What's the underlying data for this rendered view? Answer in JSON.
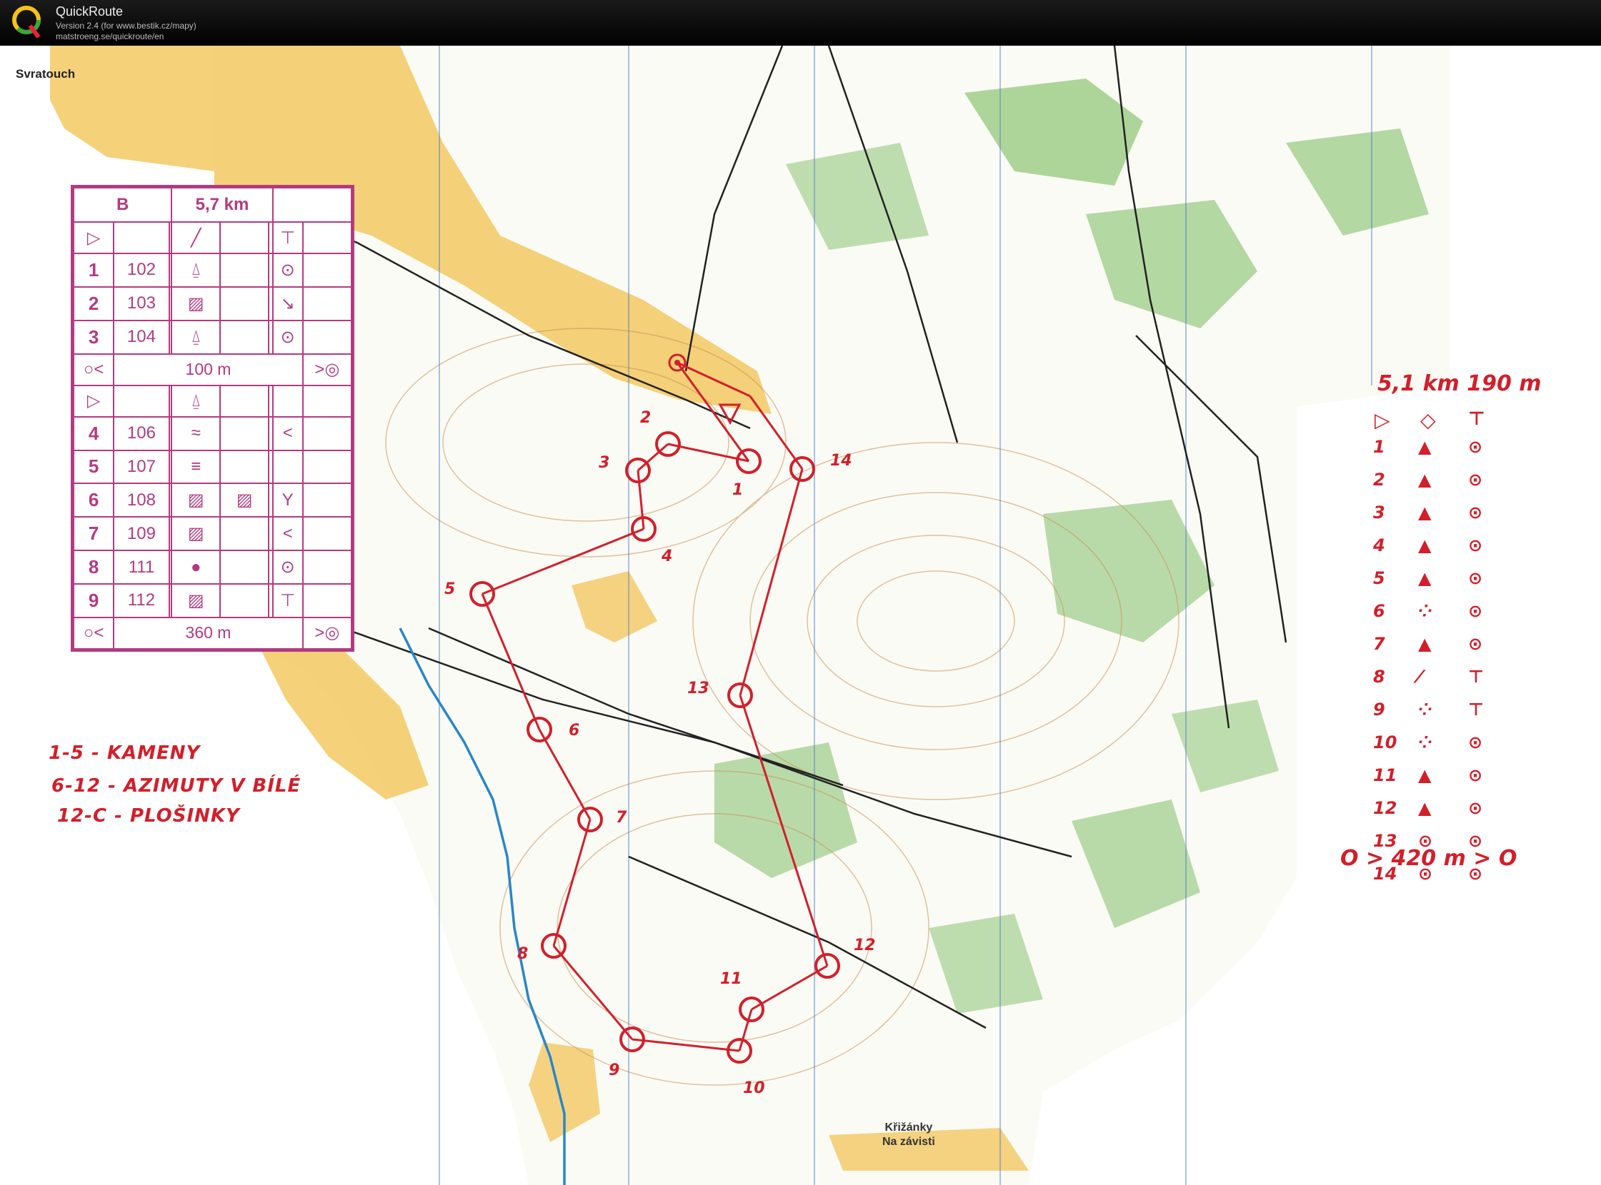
{
  "app": {
    "name": "QuickRoute",
    "version": "Version 2.4  (for www.bestik.cz/mapy)",
    "url": "matstroeng.se/quickroute/en"
  },
  "places": {
    "svratouch": "Svratouch",
    "krizanky_line1": "Křižánky",
    "krizanky_line2": "Na závisti"
  },
  "description": {
    "class": "B",
    "length": "5,7 km",
    "section1": [
      {
        "num": "1",
        "code": "102"
      },
      {
        "num": "2",
        "code": "103"
      },
      {
        "num": "3",
        "code": "104"
      }
    ],
    "marked1": "100 m",
    "section2": [
      {
        "num": "4",
        "code": "106"
      },
      {
        "num": "5",
        "code": "107"
      },
      {
        "num": "6",
        "code": "108"
      },
      {
        "num": "7",
        "code": "109"
      },
      {
        "num": "8",
        "code": "111"
      },
      {
        "num": "9",
        "code": "112"
      }
    ],
    "marked2": "360 m"
  },
  "notes": {
    "line1": "1-5 - KAMENY",
    "line2": "6-12 - AZIMUTY V BÍLÉ",
    "line3": "12-C - PLOŠINKY"
  },
  "course_legend": {
    "header": "5,1 km 190 m",
    "rows": [
      {
        "n": "1"
      },
      {
        "n": "2"
      },
      {
        "n": "3"
      },
      {
        "n": "4"
      },
      {
        "n": "5"
      },
      {
        "n": "6"
      },
      {
        "n": "7"
      },
      {
        "n": "8"
      },
      {
        "n": "9"
      },
      {
        "n": "10"
      },
      {
        "n": "11"
      },
      {
        "n": "12"
      },
      {
        "n": "13"
      },
      {
        "n": "14"
      }
    ],
    "footer": "O > 420 m > O"
  },
  "course_labels": [
    "1",
    "2",
    "3",
    "4",
    "5",
    "6",
    "7",
    "8",
    "9",
    "10",
    "11",
    "12",
    "13",
    "14"
  ],
  "colors": {
    "course": "#d21f2b",
    "description": "#b43a80",
    "open": "#f2c14e",
    "forest": "#8cc474",
    "water": "#2a86c8"
  }
}
